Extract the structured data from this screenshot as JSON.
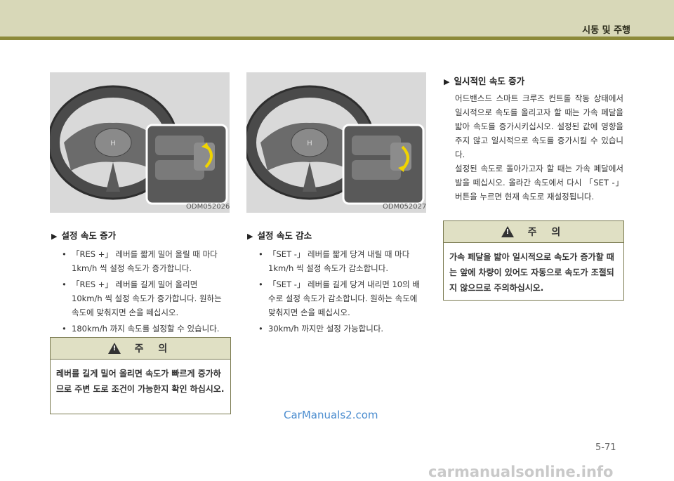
{
  "header": {
    "section_title": "시동 및 주행"
  },
  "figures": [
    {
      "code": "ODM052026",
      "arrow": "up"
    },
    {
      "code": "ODM052027",
      "arrow": "down"
    }
  ],
  "col1": {
    "heading": "설정 속도 증가",
    "bullets": [
      "「RES +」 레버를 짧게 밀어 올릴 때 마다 1km/h 씩 설정 속도가 증가합니다.",
      "「RES +」 레버를 길게 밀어 올리면 10km/h 씩 설정 속도가 증가합니다. 원하는 속도에 맞춰지면 손을 떼십시오.",
      "180km/h 까지 속도를 설정할 수 있습니다."
    ],
    "caution_title": "주 의",
    "caution_text": "레버를 길게 밀어 올리면 속도가 빠르게 증가하므로 주변 도로 조건이 가능한지 확인 하십시오."
  },
  "col2": {
    "heading": "설정 속도 감소",
    "bullets": [
      "「SET -」 레버를 짧게 당겨 내릴 때 마다 1km/h 씩 설정 속도가 감소합니다.",
      "「SET -」 레버를 길게 당겨 내리면 10의 배수로 설정 속도가 감소합니다. 원하는 속도에 맞춰지면 손을 떼십시오.",
      "30km/h 까지만 설정 가능합니다."
    ]
  },
  "col3": {
    "heading": "일시적인 속도 증가",
    "para1": "어드밴스드 스마트 크루즈 컨트롤 작동 상태에서 일시적으로 속도를 올리고자 할 때는 가속 페달을 밟아 속도를 증가시키십시오. 설정된 값에 영향을 주지 않고 일시적으로 속도를 증가시킬 수 있습니다.",
    "para2": "설정된 속도로 돌아가고자 할 때는 가속 페달에서 발을 떼십시오. 올라간 속도에서 다시 「SET -」 버튼을 누르면 현재 속도로 재설정됩니다.",
    "caution_title": "주 의",
    "caution_text": "가속 페달을 밟아 일시적으로 속도가 증가할 때는 앞에 차량이 있어도 자동으로 속도가 조절되지 않으므로 주의하십시오."
  },
  "watermark": "CarManuals2.com",
  "footer_watermark": "carmanualsonline.info",
  "page_number": "5-71"
}
